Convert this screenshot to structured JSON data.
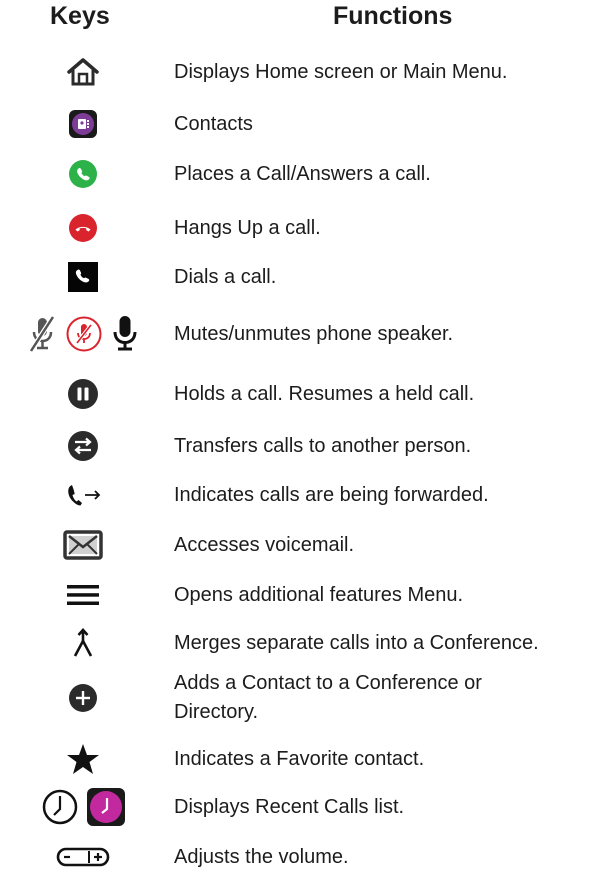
{
  "header": {
    "keys": "Keys",
    "functions": "Functions"
  },
  "rows": [
    {
      "icons": [
        "home-icon"
      ],
      "lines": [
        "Displays Home screen or Main Menu."
      ]
    },
    {
      "icons": [
        "contacts-icon"
      ],
      "lines": [
        "Contacts"
      ]
    },
    {
      "icons": [
        "place-call-icon"
      ],
      "lines": [
        "Places a Call/Answers a call."
      ]
    },
    {
      "icons": [
        "hang-up-icon"
      ],
      "lines": [
        "Hangs Up a call."
      ]
    },
    {
      "icons": [
        "dial-icon"
      ],
      "lines": [
        "Dials a call."
      ]
    },
    {
      "icons": [
        "mic-muted-icon",
        "mic-muted-circle-icon",
        "mic-icon"
      ],
      "lines": [
        "Mutes/unmutes phone speaker."
      ]
    },
    {
      "icons": [
        "hold-icon"
      ],
      "lines": [
        "Holds a call. Resumes a held call."
      ]
    },
    {
      "icons": [
        "transfer-icon"
      ],
      "lines": [
        "Transfers calls to another person."
      ]
    },
    {
      "icons": [
        "call-forward-icon"
      ],
      "lines": [
        "Indicates calls are being forwarded."
      ]
    },
    {
      "icons": [
        "voicemail-icon"
      ],
      "lines": [
        "Accesses voicemail."
      ]
    },
    {
      "icons": [
        "menu-icon"
      ],
      "lines": [
        "Opens additional features Menu."
      ]
    },
    {
      "icons": [
        "merge-icon"
      ],
      "lines": [
        "Merges separate calls into a Conference."
      ]
    },
    {
      "icons": [
        "add-icon"
      ],
      "lines": [
        "Adds a Contact to a Conference or",
        "Directory."
      ]
    },
    {
      "icons": [
        "star-icon"
      ],
      "lines": [
        "Indicates a Favorite contact."
      ]
    },
    {
      "icons": [
        "clock-icon",
        "recent-calls-icon"
      ],
      "lines": [
        "Displays Recent Calls list."
      ]
    },
    {
      "icons": [
        "volume-icon"
      ],
      "lines": [
        "Adjusts the volume."
      ]
    }
  ],
  "colors": {
    "text": "#1c1c1c",
    "contacts_purple": "#7d3c98",
    "call_green": "#2db24a",
    "hangup_red": "#d9232d",
    "recent_magenta": "#c2299e",
    "dark_icon": "#2b2b2b"
  }
}
